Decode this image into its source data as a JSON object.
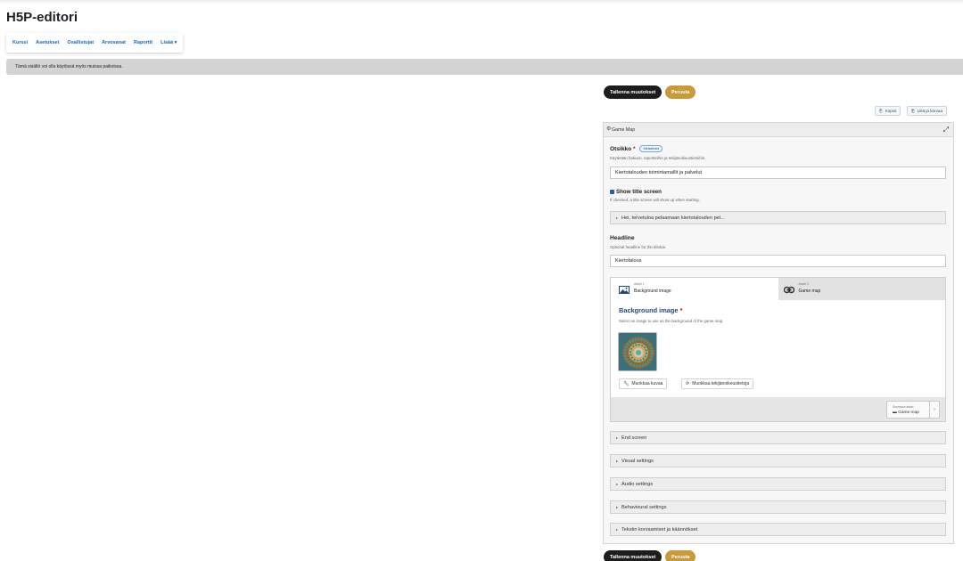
{
  "page": {
    "title": "H5P-editori"
  },
  "nav": {
    "items": [
      "Kurssi",
      "Asetukset",
      "Osallistujat",
      "Arvosanat",
      "Raportit",
      "Lisää ▾"
    ]
  },
  "notice": {
    "text": "Tämä sisältö voi olla käytössä myös muissa paikoissa."
  },
  "actions": {
    "save": "Tallenna muutokset",
    "cancel": "Peruuta"
  },
  "toolbar": {
    "copy": "Kopioi",
    "paste": "Liitä ja korvaa"
  },
  "panel": {
    "title": "Game Map",
    "otsikko": {
      "label": "Otsikko",
      "badge": "Metatiedot",
      "desc": "Käytetään hakuun, raportteihin ja tekijänoikeustietoihin.",
      "value": "Kiertotalouden toimintamallit ja palvelut"
    },
    "show_title": {
      "label": "Show title screen",
      "desc": "If checked, a title screen will show up when starting.",
      "collapsed": "Hei, tervetuloa pelaamaan kiertotalouden pel..."
    },
    "headline": {
      "label": "Headline",
      "desc": "Optional headline for the titlebar.",
      "value": "Kiertotalous"
    },
    "tabs": [
      {
        "step": "Askel 1",
        "name": "Background image"
      },
      {
        "step": "Askel 2",
        "name": "Game map"
      }
    ],
    "bg_image": {
      "label": "Background image",
      "desc": "Select an image to use as the background of the game map.",
      "edit_image": "Muokkaa kuvaa",
      "edit_copyright": "Muokkaa tekijänoikeustietoja"
    },
    "next": {
      "small": "Seuraava askel",
      "label": "Game map"
    },
    "sections": [
      "End screen",
      "Visual settings",
      "Audio settings",
      "Behavioural settings",
      "Tekstin korvaamiset ja käännökset"
    ]
  },
  "colors": {
    "link": "#0f6cbf",
    "dark_button": "#1d1d1d",
    "gold_button": "#c99a3b",
    "notice": "#d3d3d3",
    "required": "#dd0000"
  }
}
